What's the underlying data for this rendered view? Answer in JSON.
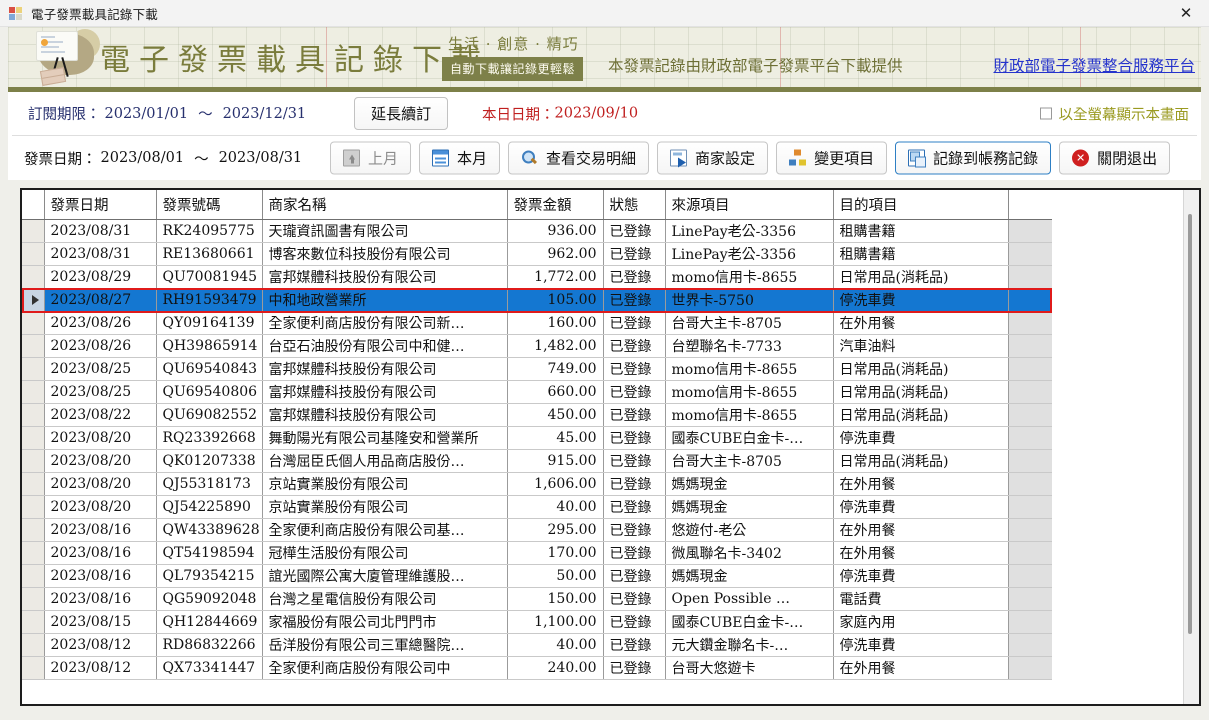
{
  "window": {
    "title": "電子發票載具記錄下載",
    "app_icon": "app-tiles-icon",
    "close_label": "✕"
  },
  "banner": {
    "title": "電子發票載具記錄下載",
    "slogan": "生活 · 創意 · 精巧",
    "badge": "自動下載讓記錄更輕鬆",
    "source_note": "本發票記錄由財政部電子發票平台下載提供",
    "link_text": "財政部電子發票整合服務平台",
    "title_color": "#7a7c3c",
    "bar_color": "#7d8049",
    "link_color": "#2533cc"
  },
  "filters": {
    "subscription_label": "訂閱期限：",
    "subscription_start": "2023/01/01",
    "subscription_end": "2023/12/31",
    "tilde": "～",
    "extend_button": "延長續訂",
    "today_label": "本日日期：",
    "today_value": "2023/09/10",
    "today_color": "#c01f1f",
    "fullscreen_label": "以全螢幕顯示本畫面",
    "fullscreen_checked": false,
    "invoice_date_label": "發票日期：",
    "invoice_date_start": "2023/08/01",
    "invoice_date_end": "2023/08/31"
  },
  "toolbar": {
    "buttons": [
      {
        "label": "上月",
        "icon": "previous-month-icon",
        "state": "disabled"
      },
      {
        "label": "本月",
        "icon": "this-month-icon",
        "state": "normal"
      },
      {
        "label": "查看交易明細",
        "icon": "search-icon",
        "state": "normal"
      },
      {
        "label": "商家設定",
        "icon": "merchant-settings-icon",
        "state": "normal"
      },
      {
        "label": "變更項目",
        "icon": "change-item-icon",
        "state": "normal"
      },
      {
        "label": "記錄到帳務記錄",
        "icon": "record-to-books-icon",
        "state": "accent"
      },
      {
        "label": "關閉退出",
        "icon": "close-exit-icon",
        "state": "normal"
      }
    ]
  },
  "table": {
    "columns": [
      "發票日期",
      "發票號碼",
      "商家名稱",
      "發票金額",
      "狀態",
      "來源項目",
      "目的項目"
    ],
    "selected_row_index": 3,
    "selection_border_color": "#e01b1b",
    "selection_fill_color": "#1477d1",
    "rows": [
      {
        "date": "2023/08/31",
        "no": "RK24095775",
        "name": "天瓏資訊圖書有限公司",
        "amount": "936.00",
        "status": "已登錄",
        "source": "LinePay老公-3356",
        "target": "租購書籍"
      },
      {
        "date": "2023/08/31",
        "no": "RE13680661",
        "name": "博客來數位科技股份有限公司",
        "amount": "962.00",
        "status": "已登錄",
        "source": "LinePay老公-3356",
        "target": "租購書籍"
      },
      {
        "date": "2023/08/29",
        "no": "QU70081945",
        "name": "富邦媒體科技股份有限公司",
        "amount": "1,772.00",
        "status": "已登錄",
        "source": "momo信用卡-8655",
        "target": "日常用品(消耗品)"
      },
      {
        "date": "2023/08/27",
        "no": "RH91593479",
        "name": "中和地政營業所",
        "amount": "105.00",
        "status": "已登錄",
        "source": "世界卡-5750",
        "target": "停洗車費"
      },
      {
        "date": "2023/08/26",
        "no": "QY09164139",
        "name": "全家便利商店股份有限公司新…",
        "amount": "160.00",
        "status": "已登錄",
        "source": "台哥大主卡-8705",
        "target": "在外用餐"
      },
      {
        "date": "2023/08/26",
        "no": "QH39865914",
        "name": "台亞石油股份有限公司中和健…",
        "amount": "1,482.00",
        "status": "已登錄",
        "source": "台塑聯名卡-7733",
        "target": "汽車油料"
      },
      {
        "date": "2023/08/25",
        "no": "QU69540843",
        "name": "富邦媒體科技股份有限公司",
        "amount": "749.00",
        "status": "已登錄",
        "source": "momo信用卡-8655",
        "target": "日常用品(消耗品)"
      },
      {
        "date": "2023/08/25",
        "no": "QU69540806",
        "name": "富邦媒體科技股份有限公司",
        "amount": "660.00",
        "status": "已登錄",
        "source": "momo信用卡-8655",
        "target": "日常用品(消耗品)"
      },
      {
        "date": "2023/08/22",
        "no": "QU69082552",
        "name": "富邦媒體科技股份有限公司",
        "amount": "450.00",
        "status": "已登錄",
        "source": "momo信用卡-8655",
        "target": "日常用品(消耗品)"
      },
      {
        "date": "2023/08/20",
        "no": "RQ23392668",
        "name": "舞動陽光有限公司基隆安和營業所",
        "amount": "45.00",
        "status": "已登錄",
        "source": "國泰CUBE白金卡-…",
        "target": "停洗車費"
      },
      {
        "date": "2023/08/20",
        "no": "QK01207338",
        "name": "台灣屈臣氏個人用品商店股份…",
        "amount": "915.00",
        "status": "已登錄",
        "source": "台哥大主卡-8705",
        "target": "日常用品(消耗品)"
      },
      {
        "date": "2023/08/20",
        "no": "QJ55318173",
        "name": "京站實業股份有限公司",
        "amount": "1,606.00",
        "status": "已登錄",
        "source": "媽媽現金",
        "target": "在外用餐"
      },
      {
        "date": "2023/08/20",
        "no": "QJ54225890",
        "name": "京站實業股份有限公司",
        "amount": "40.00",
        "status": "已登錄",
        "source": "媽媽現金",
        "target": "停洗車費"
      },
      {
        "date": "2023/08/16",
        "no": "QW43389628",
        "name": "全家便利商店股份有限公司基…",
        "amount": "295.00",
        "status": "已登錄",
        "source": "悠遊付-老公",
        "target": "在外用餐"
      },
      {
        "date": "2023/08/16",
        "no": "QT54198594",
        "name": "冠樺生活股份有限公司",
        "amount": "170.00",
        "status": "已登錄",
        "source": "微風聯名卡-3402",
        "target": "在外用餐"
      },
      {
        "date": "2023/08/16",
        "no": "QL79354215",
        "name": "誼光國際公寓大廈管理維護股…",
        "amount": "50.00",
        "status": "已登錄",
        "source": "媽媽現金",
        "target": "停洗車費"
      },
      {
        "date": "2023/08/16",
        "no": "QG59092048",
        "name": "台灣之星電信股份有限公司",
        "amount": "150.00",
        "status": "已登錄",
        "source": "Open Possible …",
        "target": "電話費"
      },
      {
        "date": "2023/08/15",
        "no": "QH12844669",
        "name": "家福股份有限公司北門門市",
        "amount": "1,100.00",
        "status": "已登錄",
        "source": "國泰CUBE白金卡-…",
        "target": "家庭內用"
      },
      {
        "date": "2023/08/12",
        "no": "RD86832266",
        "name": "岳洋股份有限公司三軍總醫院…",
        "amount": "40.00",
        "status": "已登錄",
        "source": "元大鑽金聯名卡-…",
        "target": "停洗車費"
      },
      {
        "date": "2023/08/12",
        "no": "QX73341447",
        "name": "全家便利商店股份有限公司中",
        "amount": "240.00",
        "status": "已登錄",
        "source": "台哥大悠遊卡",
        "target": "在外用餐"
      }
    ]
  }
}
